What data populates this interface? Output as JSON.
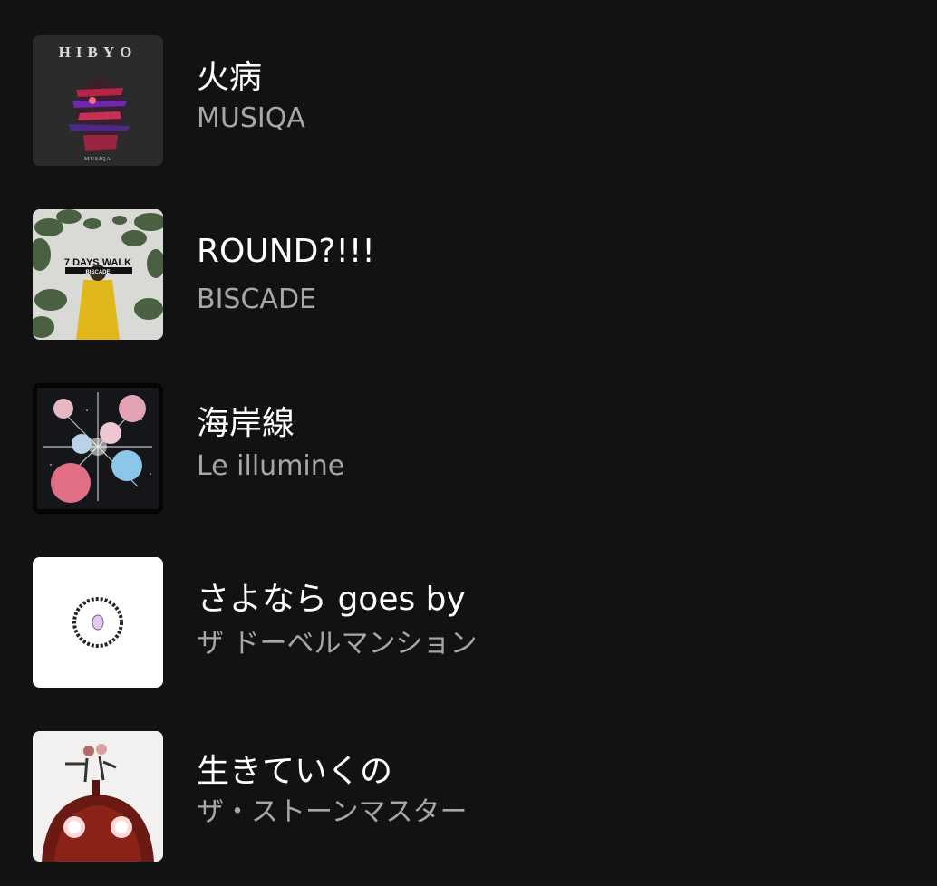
{
  "tracks": [
    {
      "title": "火病",
      "artist": "MUSIQA",
      "cover": {
        "icon": "album-cover-hibyo",
        "header_text": "HIBYO",
        "footer_text": "MUSIQA"
      }
    },
    {
      "title": "ROUND?!!!",
      "artist": "BISCADE",
      "cover": {
        "icon": "album-cover-7-days-walk",
        "header_text": "7 DAYS WALK",
        "footer_text": "BISCADE"
      }
    },
    {
      "title": "海岸線",
      "artist": "Le illumine",
      "cover": {
        "icon": "album-cover-planets"
      }
    },
    {
      "title": "さよなら goes by",
      "artist": "ザ ドーベルマンション",
      "cover": {
        "icon": "album-cover-sayonara-goes-by"
      }
    },
    {
      "title": "生きていくの",
      "artist": "ザ・ストーンマスター",
      "cover": {
        "icon": "album-cover-red-robot"
      }
    }
  ]
}
